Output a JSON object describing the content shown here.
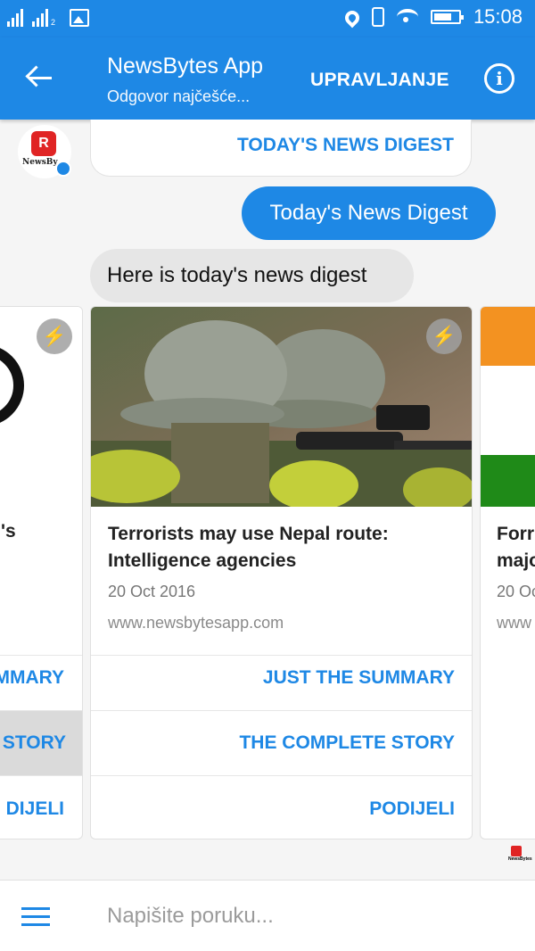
{
  "status_bar": {
    "time": "15:08",
    "sim2_label": "2",
    "icons": [
      "signal-icon",
      "signal-icon",
      "gallery-icon",
      "location-icon",
      "vibrate-icon",
      "wifi-icon",
      "battery-icon"
    ]
  },
  "header": {
    "title": "NewsBytes App",
    "subtitle": "Odgovor najčešće...",
    "manage_label": "UPRAVLJANJE",
    "info_glyph": "i"
  },
  "avatar": {
    "logo_letter": "R",
    "brand": "NewsBy"
  },
  "conversation": {
    "previous_card_button": "TODAY'S NEWS DIGEST",
    "outgoing_message": "Today's News Digest",
    "incoming_message": "Here is today's news digest"
  },
  "carousel": {
    "left_card": {
      "title_fragment": "'s",
      "buttons": [
        "MMARY",
        "STORY",
        "DIJELI"
      ]
    },
    "main_card": {
      "title": "Terrorists may use Nepal route: Intelligence agencies",
      "date": "20 Oct 2016",
      "source": "www.newsbytesapp.com",
      "buttons": [
        "JUST THE SUMMARY",
        "THE COMPLETE STORY",
        "PODIJELI"
      ]
    },
    "right_card": {
      "title_line1": "Forr",
      "title_line2": "majo",
      "date": "20 Oc",
      "source": "www"
    },
    "bolt_glyph": "⚡"
  },
  "read_receipt": {
    "brand": "NewsBytes"
  },
  "composer": {
    "placeholder": "Napišite poruku..."
  },
  "colors": {
    "accent": "#1e88e5",
    "bubble_in": "#e6e6e6",
    "background": "#f5f5f5"
  }
}
